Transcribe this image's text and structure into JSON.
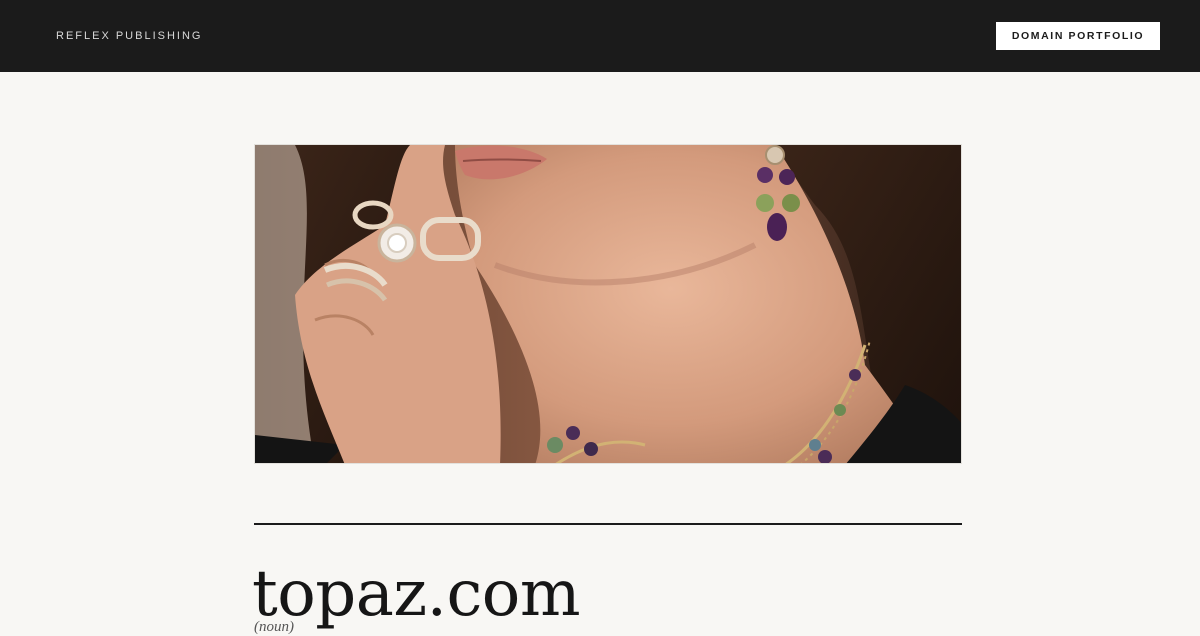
{
  "header": {
    "brand": "REFLEX PUBLISHING",
    "portfolio_button": "DOMAIN PORTFOLIO"
  },
  "hero": {
    "alt": "Woman wearing rings, drop earrings and a beaded necklace"
  },
  "listing": {
    "domain": "topaz.com",
    "part_of_speech": "(noun)"
  },
  "colors": {
    "header_bg": "#1b1b1b",
    "page_bg": "#f8f7f4",
    "text": "#161616"
  }
}
